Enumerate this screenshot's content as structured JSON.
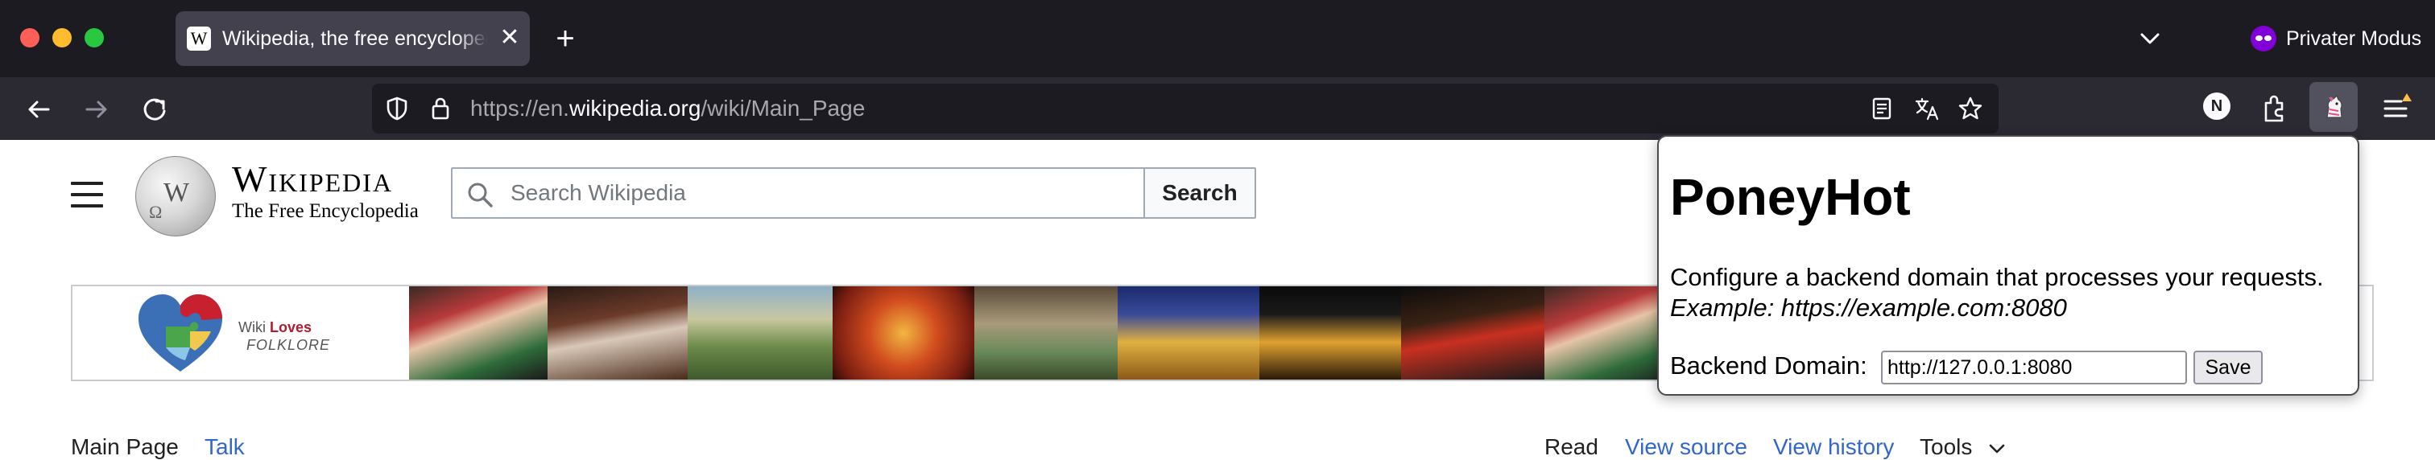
{
  "browser": {
    "tab": {
      "favicon_letter": "W",
      "title": "Wikipedia, the free encyclopedia",
      "close_glyph": "✕"
    },
    "new_tab_glyph": "+",
    "private_mode_label": "Privater Modus",
    "url": {
      "prefix": "https://en.",
      "domain": "wikipedia.org",
      "path": "/wiki/Main_Page"
    },
    "account_badge": "N",
    "icons": [
      "back-icon",
      "forward-icon",
      "reload-icon",
      "shield-icon",
      "lock-icon",
      "reader-view-icon",
      "translate-icon",
      "bookmark-star-icon",
      "account-icon",
      "extensions-icon",
      "poneyhot-extension-icon",
      "app-menu-icon",
      "tab-list-icon",
      "private-mode-icon"
    ],
    "colors": {
      "tabbar": "#1c1b22",
      "navbar": "#2b2a33",
      "private": "#8000d7"
    }
  },
  "wiki": {
    "wordmark_title": "Wikipedia",
    "wordmark_tagline": "The Free Encyclopedia",
    "search_placeholder": "Search Wikipedia",
    "search_button": "Search",
    "banner": {
      "wiki": "Wiki",
      "loves": "Loves",
      "folklore": "FOLKLORE"
    },
    "tabs": {
      "main_page": "Main Page",
      "talk": "Talk",
      "read": "Read",
      "view_source": "View source",
      "view_history": "View history",
      "tools": "Tools"
    },
    "colors": {
      "link": "#3366cc",
      "text": "#202122"
    }
  },
  "popup": {
    "title": "PoneyHot",
    "description": "Configure a backend domain that processes your requests.",
    "example": "Example: https://example.com:8080",
    "domain_label": "Backend Domain:",
    "domain_value": "http://127.0.0.1:8080",
    "save_label": "Save"
  }
}
